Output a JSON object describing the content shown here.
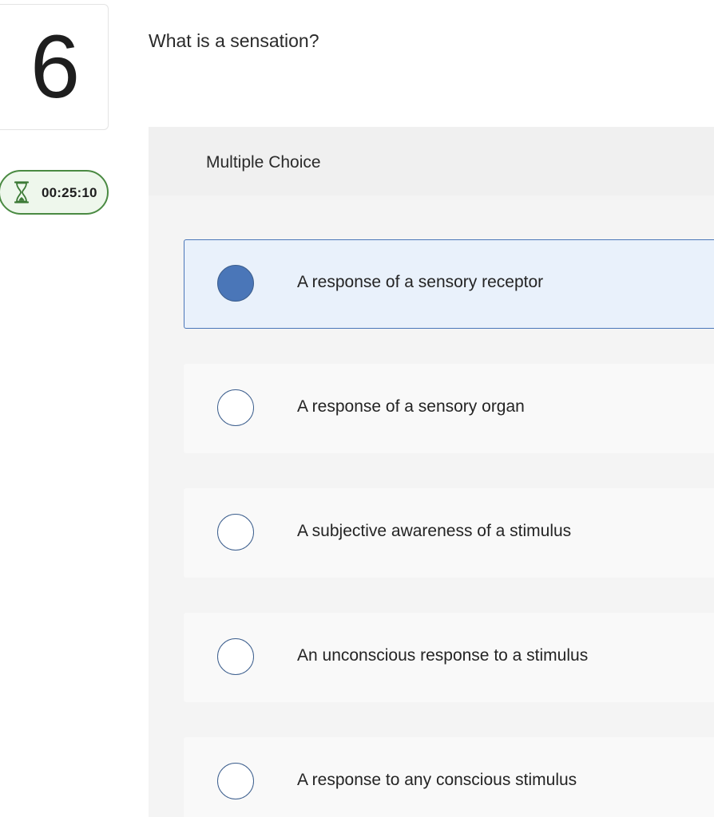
{
  "question": {
    "number": "6",
    "text": "What is a sensation?"
  },
  "timer": {
    "icon": "hourglass-icon",
    "time": "00:25:10",
    "color": "#4a8a42"
  },
  "panel": {
    "type_label": "Multiple Choice"
  },
  "options": [
    {
      "label": "A response of a sensory receptor",
      "selected": true
    },
    {
      "label": "A response of a sensory organ",
      "selected": false
    },
    {
      "label": "A subjective awareness of a stimulus",
      "selected": false
    },
    {
      "label": "An unconscious response to a stimulus",
      "selected": false
    },
    {
      "label": "A response to any conscious stimulus",
      "selected": false
    }
  ],
  "colors": {
    "accent": "#4a76b8",
    "selected_bg": "#e9f1fb"
  }
}
